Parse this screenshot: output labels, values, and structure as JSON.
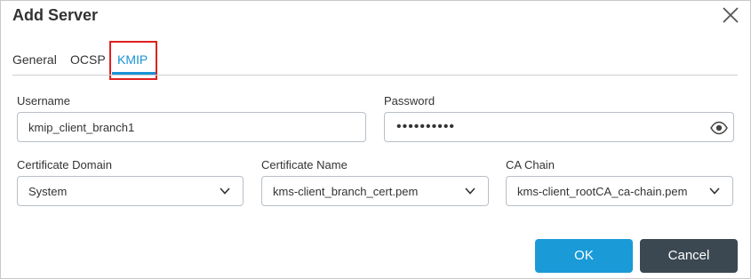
{
  "dialog": {
    "title": "Add Server",
    "close_icon": "close-icon"
  },
  "tabs": [
    {
      "label": "General",
      "active": false
    },
    {
      "label": "OCSP",
      "active": false
    },
    {
      "label": "KMIP",
      "active": true
    }
  ],
  "form": {
    "username": {
      "label": "Username",
      "value": "kmip_client_branch1"
    },
    "password": {
      "label": "Password",
      "value": "••••••••••",
      "reveal_icon": "eye-icon"
    },
    "certificate_domain": {
      "label": "Certificate Domain",
      "value": "System"
    },
    "certificate_name": {
      "label": "Certificate Name",
      "value": "kms-client_branch_cert.pem"
    },
    "ca_chain": {
      "label": "CA Chain",
      "value": "kms-client_rootCA_ca-chain.pem"
    }
  },
  "buttons": {
    "ok_label": "OK",
    "cancel_label": "Cancel"
  },
  "colors": {
    "accent": "#1b92d6",
    "highlight_box": "#e02020",
    "ok_button": "#1b9ad8",
    "cancel_button": "#3b4852"
  }
}
